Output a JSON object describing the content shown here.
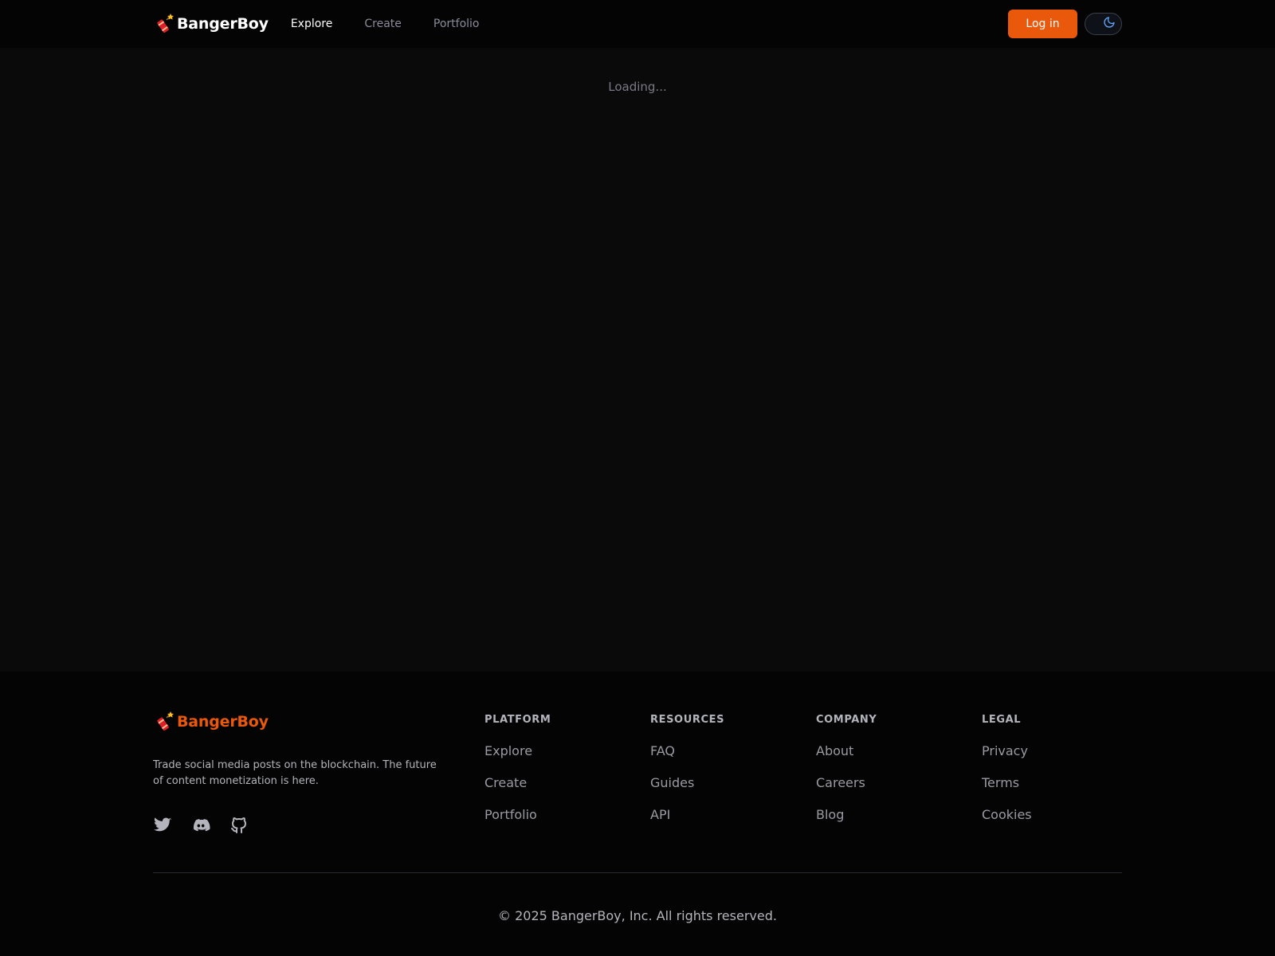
{
  "header": {
    "brand": "BangerBoy",
    "nav": [
      {
        "label": "Explore",
        "active": true
      },
      {
        "label": "Create",
        "active": false
      },
      {
        "label": "Portfolio",
        "active": false
      }
    ],
    "login_label": "Log in",
    "theme_icon": "moon-icon"
  },
  "main": {
    "loading_text": "Loading..."
  },
  "footer": {
    "brand": "BangerBoy",
    "tagline": "Trade social media posts on the blockchain. The future of content monetization is here.",
    "socials": [
      "twitter-icon",
      "discord-icon",
      "github-icon"
    ],
    "columns": [
      {
        "title": "PLATFORM",
        "links": [
          "Explore",
          "Create",
          "Portfolio"
        ]
      },
      {
        "title": "RESOURCES",
        "links": [
          "FAQ",
          "Guides",
          "API"
        ]
      },
      {
        "title": "COMPANY",
        "links": [
          "About",
          "Careers",
          "Blog"
        ]
      },
      {
        "title": "LEGAL",
        "links": [
          "Privacy",
          "Terms",
          "Cookies"
        ]
      }
    ],
    "copyright": "© 2025 BangerBoy, Inc. All rights reserved."
  },
  "colors": {
    "accent": "#ea580c",
    "background": "#0a0a0a",
    "header_bg": "#040404"
  }
}
